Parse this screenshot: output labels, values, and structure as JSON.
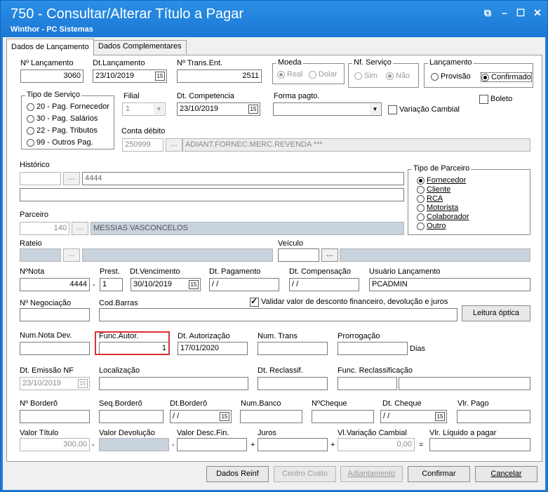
{
  "window": {
    "title": "750 - Consultar/Alterar Título a Pagar",
    "subtitle": "Winthor - PC Sistemas",
    "controls": [
      "restore-icon",
      "minimize-icon",
      "maximize-icon",
      "close-icon"
    ]
  },
  "tabs": [
    {
      "label": "Dados de Lançamento",
      "active": true
    },
    {
      "label": "Dados Complementares",
      "active": false
    }
  ],
  "row1": {
    "n_lanc": {
      "label": "Nº Lançamento",
      "value": "3060"
    },
    "dt_lanc": {
      "label": "Dt.Lançamento",
      "value": "23/10/2019"
    },
    "n_trans": {
      "label": "Nº Trans.Ent.",
      "value": "2511"
    },
    "moeda": {
      "title": "Moeda",
      "options": [
        "Real",
        "Dolar"
      ],
      "selected": "Real"
    },
    "nf_servico": {
      "title": "Nf. Serviço",
      "options": [
        "Sim",
        "Não"
      ],
      "selected": "Não"
    },
    "lancamento": {
      "title": "Lançamento",
      "options": [
        "Provisão",
        "Confirmado"
      ],
      "selected": "Confirmado"
    }
  },
  "tipo_servico": {
    "title": "Tipo de Serviço",
    "options": [
      "20 - Pag. Fornecedor",
      "30 - Pag. Salários",
      "22 - Pag. Tributos",
      "99 - Outros Pag."
    ]
  },
  "filial": {
    "label": "Filial",
    "value": "1"
  },
  "dt_competencia": {
    "label": "Dt. Competencia",
    "value": "23/10/2019"
  },
  "forma_pagto": {
    "label": "Forma pagto.",
    "value": ""
  },
  "boleto": {
    "label": "Boleto",
    "checked": false
  },
  "variacao_cambial": {
    "label": "Variação Cambial",
    "checked": false
  },
  "conta_debito": {
    "label": "Conta débito",
    "code": "250999",
    "desc": "ADIANT.FORNEC.MERC.REVENDA ***"
  },
  "historico": {
    "label": "Histórico",
    "code": "",
    "text": "4444",
    "line2": ""
  },
  "tipo_parceiro": {
    "title": "Tipo de Parceiro",
    "options": [
      "Fornecedor",
      "Cliente",
      "RCA",
      "Motorista",
      "Colaborador",
      "Outro"
    ],
    "selected": "Fornecedor"
  },
  "parceiro": {
    "label": "Parceiro",
    "code": "140",
    "name": "MESSIAS VASCONCELOS"
  },
  "rateio": {
    "label": "Rateio",
    "value": ""
  },
  "veiculo": {
    "label": "Veículo",
    "value": ""
  },
  "row_nota": {
    "n_nota": {
      "label": "NºNota",
      "value": "4444"
    },
    "prest": {
      "label": "Prest.",
      "value": "1"
    },
    "dt_venc": {
      "label": "Dt.Vencimento",
      "value": "30/10/2019"
    },
    "dt_pag": {
      "label": "Dt. Pagamento",
      "value": "/ /"
    },
    "dt_comp": {
      "label": "Dt. Compensação",
      "value": "/ /"
    },
    "usuario": {
      "label": "Usuário Lançamento",
      "value": "PCADMIN"
    }
  },
  "n_negociacao": {
    "label": "Nº Negociação",
    "value": ""
  },
  "cod_barras": {
    "label": "Cod.Barras",
    "value": ""
  },
  "validar": {
    "label": "Validar valor de desconto financeiro,  devolução e juros",
    "checked": true
  },
  "leitura_optica": {
    "label": "Leitura óptica"
  },
  "row_dev": {
    "num_nota_dev": {
      "label": "Num.Nota Dev.",
      "value": ""
    },
    "func_autor": {
      "label": "Func.Autor.",
      "value": "1"
    },
    "dt_autorizacao": {
      "label": "Dt. Autorização",
      "value": "17/01/2020"
    },
    "num_trans": {
      "label": "Num. Trans",
      "value": ""
    },
    "prorrogacao": {
      "label": "Prorrogação",
      "value": "",
      "unit": "Dias"
    }
  },
  "row_emissao": {
    "dt_emissao": {
      "label": "Dt. Emissão NF",
      "value": "23/10/2019"
    },
    "localizacao": {
      "label": "Localização",
      "value": ""
    },
    "dt_reclass": {
      "label": "Dt. Reclassif.",
      "value": ""
    },
    "func_reclass": {
      "label": "Func. Reclassificação",
      "value": ""
    }
  },
  "row_bordero": {
    "n_bordero": {
      "label": "Nº Borderô",
      "value": ""
    },
    "seq_bordero": {
      "label": "Seq.Borderô",
      "value": ""
    },
    "dt_bordero": {
      "label": "Dt.Borderô",
      "value": "/ /"
    },
    "num_banco": {
      "label": "Num.Banco",
      "value": ""
    },
    "n_cheque": {
      "label": "NºCheque",
      "value": ""
    },
    "dt_cheque": {
      "label": "Dt. Cheque",
      "value": "/ /"
    },
    "vlr_pago": {
      "label": "Vlr. Pago",
      "value": ""
    }
  },
  "row_valor": {
    "valor_titulo": {
      "label": "Valor Título",
      "value": "300,00"
    },
    "valor_devolucao": {
      "label": "Valor Devolução",
      "value": ""
    },
    "valor_desc": {
      "label": "Valor Desc.Fin.",
      "value": ""
    },
    "juros": {
      "label": "Juros",
      "value": ""
    },
    "vl_variacao": {
      "label": "Vl.Variação Cambial",
      "value": "0,00"
    },
    "vlr_liquido": {
      "label": "Vlr. Líquido a pagar",
      "value": ""
    },
    "ops": [
      "-",
      "-",
      "+",
      "+",
      "="
    ]
  },
  "buttons": {
    "dados_reinf": "Dados Reinf",
    "centro_custo": "Centro Custo",
    "adiantamento": "Adiantamento",
    "confirmar": "Confirmar",
    "cancelar": "Cancelar"
  },
  "cal_glyph": "15",
  "dots_glyph": "..."
}
